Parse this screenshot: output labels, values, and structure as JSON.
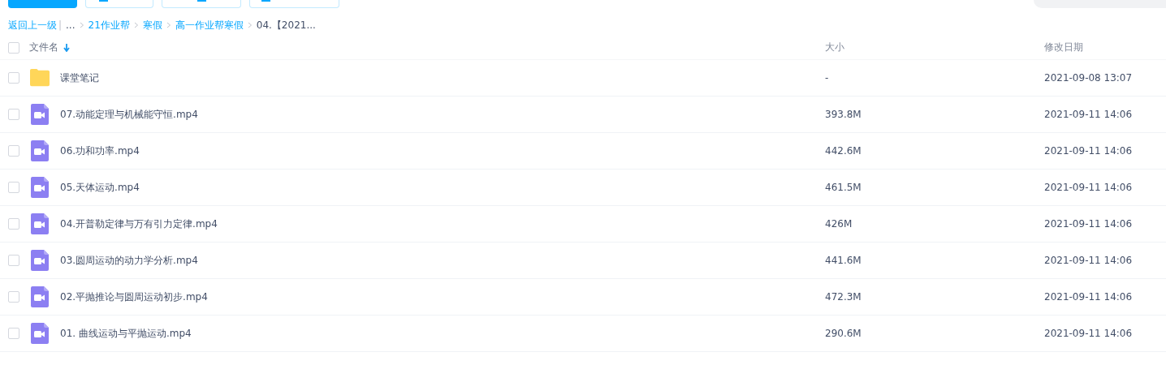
{
  "toolbar": {
    "buttons": [
      {
        "kind": "primary"
      },
      {
        "kind": "outline"
      },
      {
        "kind": "outline"
      },
      {
        "kind": "outline"
      }
    ]
  },
  "breadcrumb": {
    "back": "返回上一级",
    "separator": "|",
    "items": [
      {
        "label": "...",
        "link": false
      },
      {
        "label": "21作业帮",
        "link": true
      },
      {
        "label": "寒假",
        "link": true
      },
      {
        "label": "高一作业帮寒假",
        "link": true
      },
      {
        "label": "04.【2021...",
        "link": false
      }
    ]
  },
  "table": {
    "all_checked": false,
    "columns": [
      {
        "label": "文件名",
        "sorted": true
      },
      {
        "label": "大小",
        "sorted": false
      },
      {
        "label": "修改日期",
        "sorted": false
      }
    ],
    "rows": [
      {
        "kind": "folder",
        "name": "课堂笔记",
        "size": "-",
        "date": "2021-09-08 13:07",
        "checked": false
      },
      {
        "kind": "video",
        "name": "07.动能定理与机械能守恒.mp4",
        "size": "393.8M",
        "date": "2021-09-11 14:06",
        "checked": false
      },
      {
        "kind": "video",
        "name": "06.功和功率.mp4",
        "size": "442.6M",
        "date": "2021-09-11 14:06",
        "checked": false
      },
      {
        "kind": "video",
        "name": "05.天体运动.mp4",
        "size": "461.5M",
        "date": "2021-09-11 14:06",
        "checked": false
      },
      {
        "kind": "video",
        "name": "04.开普勒定律与万有引力定律.mp4",
        "size": "426M",
        "date": "2021-09-11 14:06",
        "checked": false
      },
      {
        "kind": "video",
        "name": "03.圆周运动的动力学分析.mp4",
        "size": "441.6M",
        "date": "2021-09-11 14:06",
        "checked": false
      },
      {
        "kind": "video",
        "name": "02.平抛推论与圆周运动初步.mp4",
        "size": "472.3M",
        "date": "2021-09-11 14:06",
        "checked": false
      },
      {
        "kind": "video",
        "name": "01. 曲线运动与平抛运动.mp4",
        "size": "290.6M",
        "date": "2021-09-11 14:06",
        "checked": false
      }
    ]
  }
}
